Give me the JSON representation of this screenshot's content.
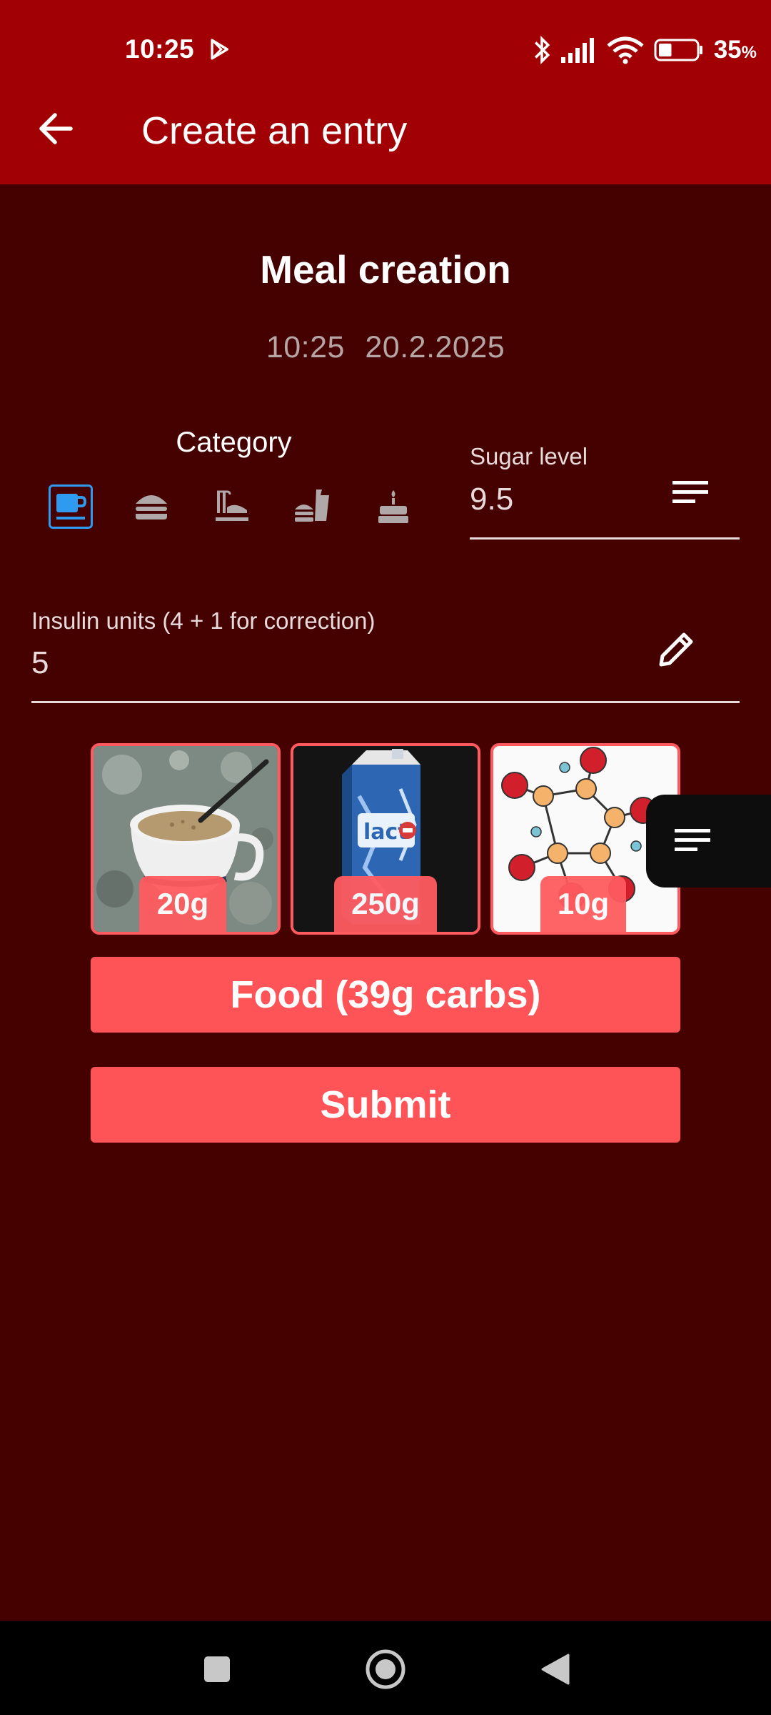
{
  "status_bar": {
    "time": "10:25",
    "battery_percent": "35",
    "battery_unit": "%",
    "battery_level": 0.35
  },
  "app_bar": {
    "title": "Create an entry"
  },
  "page": {
    "title": "Meal creation",
    "time": "10:25",
    "date": "20.2.2025"
  },
  "category": {
    "label": "Category",
    "items": [
      {
        "name": "coffee-icon",
        "selected": true
      },
      {
        "name": "burger-icon",
        "selected": false
      },
      {
        "name": "dinner-icon",
        "selected": false
      },
      {
        "name": "fastfood-icon",
        "selected": false
      },
      {
        "name": "cake-icon",
        "selected": false
      }
    ],
    "selected_color": "#2e9bf0",
    "unselected_color": "#b0a8a8"
  },
  "sugar": {
    "label": "Sugar level",
    "value": "9.5"
  },
  "insulin": {
    "label": "Insulin units (4 + 1 for correction)",
    "value": "5"
  },
  "foods": [
    {
      "name": "cereal-cup",
      "amount": "20g"
    },
    {
      "name": "milk-carton",
      "amount": "250g"
    },
    {
      "name": "sugar-molecule",
      "amount": "10g"
    }
  ],
  "buttons": {
    "food": "Food (39g carbs)",
    "submit": "Submit"
  },
  "colors": {
    "app_bar": "#a10005",
    "background": "#450000",
    "accent": "#ff5457"
  }
}
